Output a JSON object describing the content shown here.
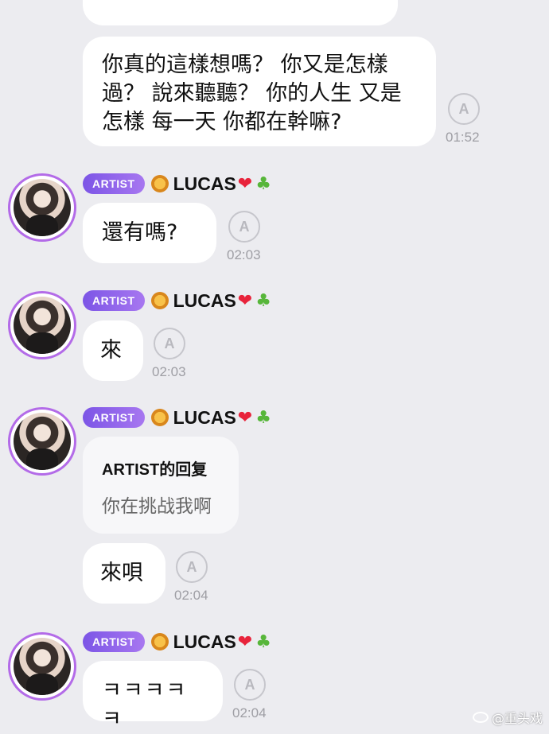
{
  "messages": [
    {
      "text": "你真的這樣想嗎？ 你又是怎樣過？ 說來聽聽？ 你的人生 又是怎樣 每一天 你都在幹嘛?",
      "time": "01:52"
    },
    {
      "sender": {
        "badge": "ARTIST",
        "name": "LUCAS"
      },
      "text": "還有嗎?",
      "time": "02:03"
    },
    {
      "sender": {
        "badge": "ARTIST",
        "name": "LUCAS"
      },
      "text": "來",
      "time": "02:03"
    },
    {
      "sender": {
        "badge": "ARTIST",
        "name": "LUCAS"
      },
      "reply": {
        "title": "ARTIST的回复",
        "body": "你在挑战我啊"
      }
    },
    {
      "text": "來唄",
      "time": "02:04"
    },
    {
      "sender": {
        "badge": "ARTIST",
        "name": "LUCAS"
      },
      "text": "ㅋㅋㅋㅋㅋ",
      "time": "02:04"
    }
  ],
  "icons": {
    "translate": "translate-icon",
    "name_prefix": "lion-emoji",
    "name_suffix": [
      "heart-emoji",
      "clover-emoji"
    ]
  },
  "translate_glyph": "A",
  "watermark": {
    "text": "@重头戏"
  },
  "colors": {
    "background": "#ececf0",
    "badge": "#8a62ec",
    "avatar_ring": "#b36be8",
    "heart": "#e8233b"
  }
}
